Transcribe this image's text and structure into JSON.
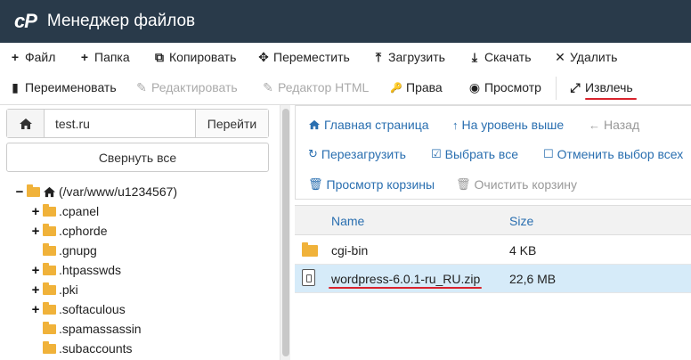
{
  "header": {
    "logo": "cP",
    "title": "Менеджер файлов"
  },
  "toolbar": {
    "row1": [
      {
        "icon": "+",
        "label": "Файл"
      },
      {
        "icon": "+",
        "label": "Папка"
      },
      {
        "icon": "⧉",
        "label": "Копировать"
      },
      {
        "icon": "✥",
        "label": "Переместить"
      },
      {
        "icon": "⤒",
        "label": "Загрузить"
      },
      {
        "icon": "⤓",
        "label": "Скачать"
      },
      {
        "icon": "✕",
        "label": "Удалить"
      }
    ],
    "row2": [
      {
        "icon": "▮",
        "label": "Переименовать"
      },
      {
        "icon": "✎",
        "label": "Редактировать"
      },
      {
        "icon": "✎",
        "label": "Редактор HTML"
      },
      {
        "icon": "🔑",
        "label": "Права"
      },
      {
        "icon": "◉",
        "label": "Просмотр"
      },
      {
        "icon": "⤢",
        "label": "Извлечь"
      }
    ]
  },
  "address": {
    "value": "test.ru",
    "go_label": "Перейти"
  },
  "collapse_label": "Свернуть все",
  "tree": {
    "root": "(/var/www/u1234567)",
    "items": [
      {
        "sign": "+",
        "label": ".cpanel"
      },
      {
        "sign": "+",
        "label": ".cphorde"
      },
      {
        "sign": "",
        "label": ".gnupg"
      },
      {
        "sign": "+",
        "label": ".htpasswds"
      },
      {
        "sign": "+",
        "label": ".pki"
      },
      {
        "sign": "+",
        "label": ".softaculous"
      },
      {
        "sign": "",
        "label": ".spamassassin"
      },
      {
        "sign": "",
        "label": ".subaccounts"
      }
    ]
  },
  "actions": {
    "home": "Главная страница",
    "up": "На уровень выше",
    "back": "Назад",
    "reload": "Перезагрузить",
    "select_all": "Выбрать все",
    "unselect_all": "Отменить выбор всех",
    "trash_view": "Просмотр корзины",
    "trash_empty": "Очистить корзину"
  },
  "table": {
    "col_name": "Name",
    "col_size": "Size",
    "rows": [
      {
        "name": "cgi-bin",
        "size": "4 KB",
        "type": "folder"
      },
      {
        "name": "wordpress-6.0.1-ru_RU.zip",
        "size": "22,6 MB",
        "type": "zip"
      }
    ]
  },
  "colors": {
    "header_bg": "#293a4a",
    "link": "#2a6fb0",
    "selected_row": "#d6ebf9",
    "highlight_underline": "#d9232d",
    "folder": "#f0b23a"
  }
}
